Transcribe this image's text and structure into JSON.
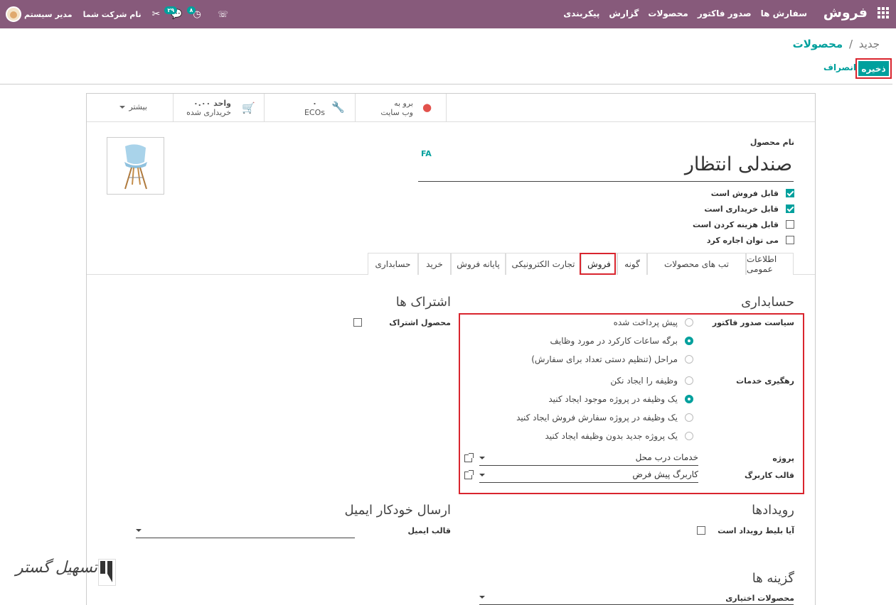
{
  "topbar": {
    "app_name": "فروش",
    "menu": [
      "سفارش ها",
      "صدور فاکتور",
      "محصولات",
      "گزارش",
      "پیکربندی"
    ],
    "badge_activities": "۸",
    "badge_messages": "۲۹",
    "company": "نام شرکت شما",
    "user": "مدیر سیستم"
  },
  "breadcrumb": {
    "parent": "محصولات",
    "separator": "/",
    "current": "جدید"
  },
  "actions": {
    "save": "ذخیره",
    "discard": "انصراف"
  },
  "smart_buttons": {
    "website_line1": "برو به",
    "website_line2": "وب سایت",
    "ecos_count": "۰",
    "ecos_label": "ECOs",
    "purchased_value": "۰.۰۰ واحد",
    "purchased_label": "خریداری شده",
    "more": "بیشتر"
  },
  "product": {
    "name_label": "نام محصول",
    "lang": "FA",
    "name": "صندلی انتظار",
    "checkboxes": [
      {
        "label": "قابل فروش است",
        "checked": true
      },
      {
        "label": "قابل خریداری است",
        "checked": true
      },
      {
        "label": "قابل هزینه کردن است",
        "checked": false
      },
      {
        "label": "می توان اجاره کرد",
        "checked": false
      }
    ]
  },
  "tabs": [
    "اطلاعات عمومی",
    "تب های محصولات",
    "گونه",
    "فروش",
    "تجارت الکترونیکی",
    "پایانه فروش",
    "خرید",
    "حسابداری"
  ],
  "active_tab": "فروش",
  "invoicing": {
    "section_title": "حسابداری",
    "policy_label": "سیاست صدور فاکتور",
    "policy_options": [
      {
        "label": "پیش پرداخت شده",
        "selected": false
      },
      {
        "label": "برگه ساعات کارکرد در مورد وظایف",
        "selected": true
      },
      {
        "label": "مراحل (تنظیم دستی تعداد برای سفارش)",
        "selected": false
      }
    ],
    "tracking_label": "رهگیری خدمات",
    "tracking_options": [
      {
        "label": "وظیفه را ایجاد نکن",
        "selected": false
      },
      {
        "label": "یک وظیفه در پروژه موجود ایجاد کنید",
        "selected": true
      },
      {
        "label": "یک وظیفه در پروژه سفارش فروش ایجاد کنید",
        "selected": false
      },
      {
        "label": "یک پروژه جدید بدون وظیفه ایجاد کنید",
        "selected": false
      }
    ],
    "project_label": "پروژه",
    "project_value": "خدمات درب محل",
    "template_label": "قالب کاربرگ",
    "template_value": "کاربرگ پیش فرض"
  },
  "subscriptions": {
    "title": "اشتراک ها",
    "product_label": "محصول اشتراک",
    "checked": false
  },
  "events": {
    "title": "رویدادها",
    "ticket_label": "آیا بلیط رویداد است",
    "checked": false
  },
  "auto_email": {
    "title": "ارسال خودکار ایمیل",
    "template_label": "قالب ایمیل",
    "template_value": ""
  },
  "options": {
    "title": "گزینه ها",
    "optional_label": "محصولات اختیاری"
  },
  "watermark": {
    "text": "تسهیل گستر"
  },
  "colors": {
    "topbar": "#875a7b",
    "accent": "#00a09d",
    "highlight": "#d9252e"
  }
}
